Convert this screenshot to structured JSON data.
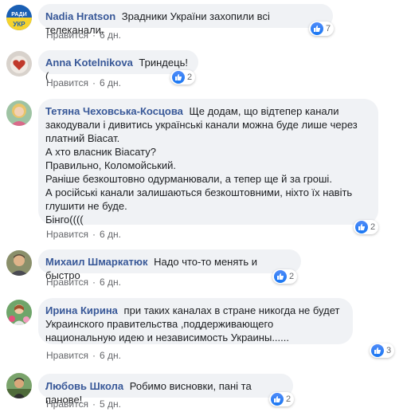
{
  "actions": {
    "like": "Нравится",
    "separator": "·"
  },
  "colors": {
    "author": "#385898",
    "bubble": "#f0f2f5",
    "reaction": "#1877f2"
  },
  "comments": [
    {
      "author": "Nadia Hratson",
      "text": "Зрадники України захопили всі телеканали.",
      "time": "6 дн.",
      "reactions": "7",
      "avatar": "avatar-radio-logo"
    },
    {
      "author": "Anna Kotelnikova",
      "text": "Триндець!(",
      "time": "6 дн.",
      "reactions": "2",
      "avatar": "avatar-heart"
    },
    {
      "author": "Тетяна Чеховська-Косцова",
      "text": "Ще додам, що відтепер канали закодували і дивитись українські канали можна буде лише через платний Віасат.\nА хто власник Віасату?\nПравильно, Коломойський.\nРаніше безкоштовно одурманювали, а тепер ще й за гроші.\nА російські канали залишаються безкоштовними, ніхто їх навіть глушити не буде.\nБінго((((",
      "time": "6 дн.",
      "reactions": "2",
      "avatar": "avatar-woman-blonde"
    },
    {
      "author": "Михаил Шмаркатюк",
      "text": "Надо что-то менять и быстро",
      "time": "6 дн.",
      "reactions": "2",
      "avatar": "avatar-man"
    },
    {
      "author": "Ирина Кирина",
      "text": "при таких каналах в стране никогда не будет Украинского правительства ,поддерживающего национальную идею и независимость Украины......",
      "time": "6 дн.",
      "reactions": "3",
      "avatar": "avatar-woman-flowers"
    },
    {
      "author": "Любовь Школа",
      "text": "Робимо висновки, пані та панове!",
      "time": "5 дн.",
      "reactions": "2",
      "avatar": "avatar-person-outdoor"
    }
  ]
}
